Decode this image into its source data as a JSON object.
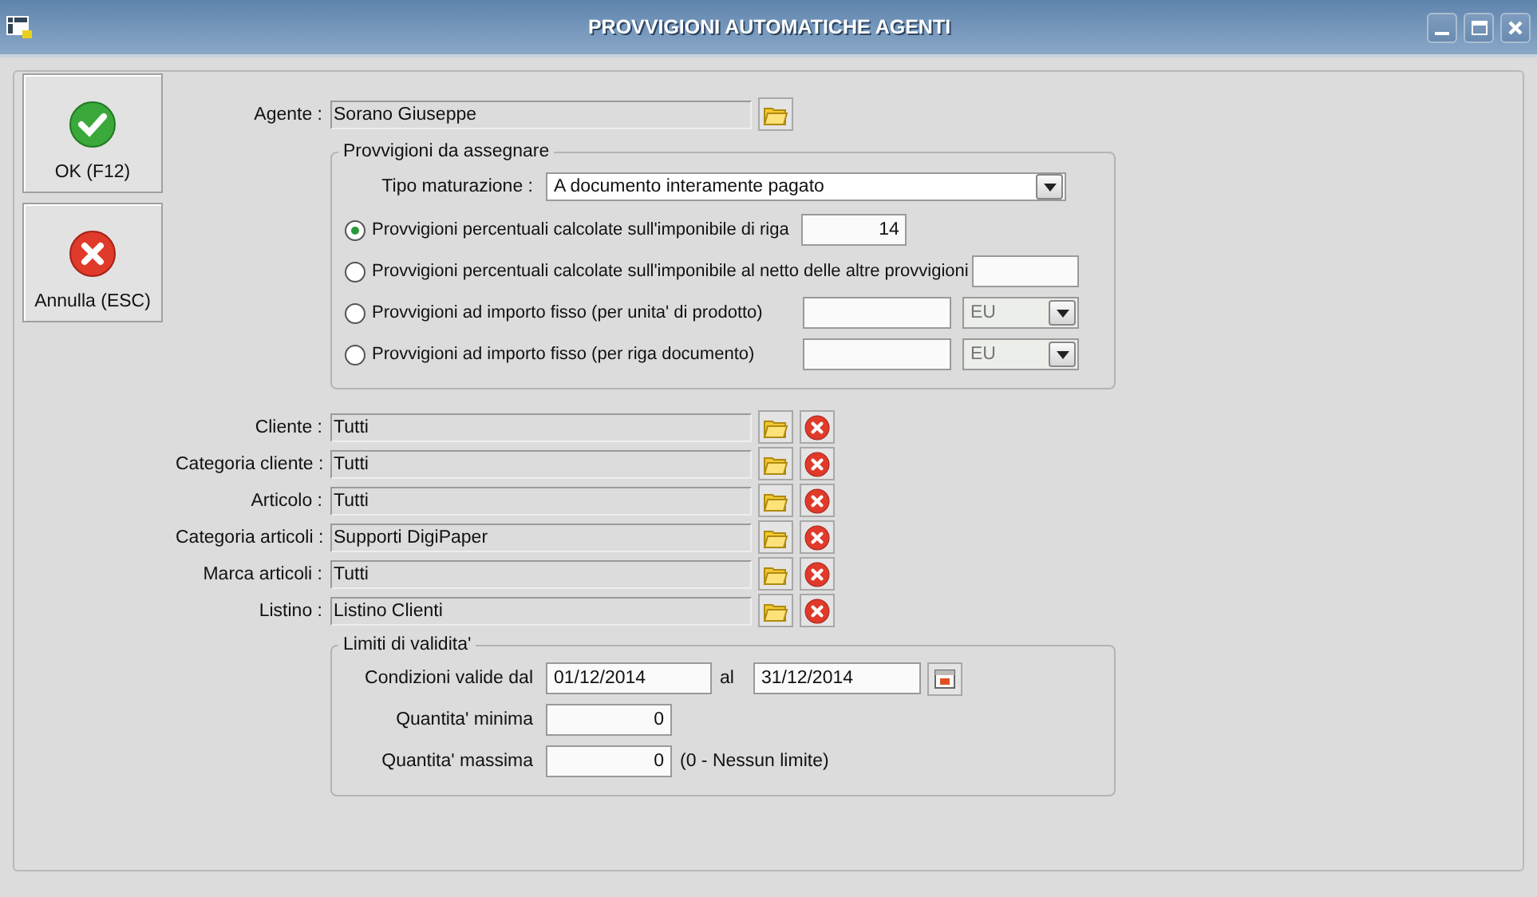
{
  "window": {
    "title": "PROVVIGIONI AUTOMATICHE AGENTI"
  },
  "actions": [
    {
      "label": "OK (F12)",
      "kind": "ok"
    },
    {
      "label": "Annulla (ESC)",
      "kind": "cancel"
    }
  ],
  "agent": {
    "label": "Agente :",
    "value": "Sorano Giuseppe"
  },
  "commission": {
    "legend": "Provvigioni da assegnare",
    "type_label": "Tipo maturazione :",
    "type_value": "A documento interamente pagato",
    "options": [
      {
        "label": "Provvigioni percentuali calcolate sull'imponibile di riga",
        "selected": true,
        "kind": "field",
        "value": "14"
      },
      {
        "label": "Provvigioni percentuali calcolate sull'imponibile al netto delle altre provvigioni",
        "selected": false,
        "kind": "field"
      },
      {
        "label": "Provvigioni ad importo fisso (per unita' di prodotto)",
        "selected": false,
        "kind": "amount",
        "unit": "EU",
        "disabled": true
      },
      {
        "label": "Provvigioni ad importo fisso (per riga documento)",
        "selected": false,
        "kind": "amount",
        "unit": "EU",
        "disabled": true
      }
    ]
  },
  "filters": [
    {
      "label": "Cliente :",
      "value": "Tutti"
    },
    {
      "label": "Categoria cliente :",
      "value": "Tutti"
    },
    {
      "label": "Articolo :",
      "value": "Tutti"
    },
    {
      "label": "Categoria articoli :",
      "value": "Supporti DigiPaper"
    },
    {
      "label": "Marca articoli :",
      "value": "Tutti"
    },
    {
      "label": "Listino :",
      "value": "Listino Clienti"
    }
  ],
  "validity": {
    "legend": "Limiti di validita'",
    "from_label": "Condizioni valide dal",
    "from": "01/12/2014",
    "to_label": "al",
    "to": "31/12/2014",
    "min_label": "Quantita' minima",
    "min": "0",
    "max_label": "Quantita' massima",
    "max": "0",
    "max_note": "(0 - Nessun limite)"
  }
}
